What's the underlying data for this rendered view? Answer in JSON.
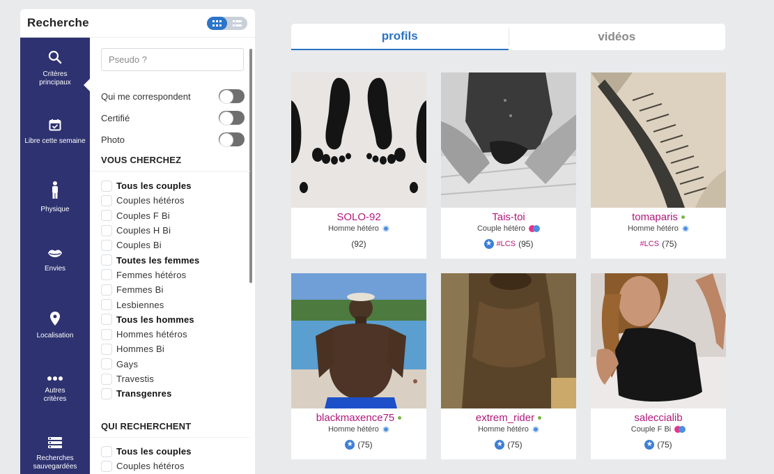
{
  "search_panel": {
    "title": "Recherche",
    "nav": [
      {
        "label_line1": "Critères",
        "label_line2": "principaux",
        "icon": "search-icon"
      },
      {
        "label_line1": "Libre cette semaine",
        "label_line2": "",
        "icon": "calendar-check-icon"
      },
      {
        "label_line1": "Physique",
        "label_line2": "",
        "icon": "person-icon"
      },
      {
        "label_line1": "Envies",
        "label_line2": "",
        "icon": "lips-icon"
      },
      {
        "label_line1": "Localisation",
        "label_line2": "",
        "icon": "map-pin-icon"
      },
      {
        "label_line1": "Autres",
        "label_line2": "critères",
        "icon": "more-dots-icon"
      },
      {
        "label_line1": "Recherches",
        "label_line2": "sauvegardées",
        "icon": "saved-list-icon"
      }
    ],
    "pseudo_placeholder": "Pseudo ?",
    "toggles": [
      {
        "label": "Qui me correspondent",
        "on": false
      },
      {
        "label": "Certifié",
        "on": false
      },
      {
        "label": "Photo",
        "on": false
      }
    ],
    "vous_cherchez": {
      "title": "VOUS CHERCHEZ",
      "options": [
        "Tous les couples",
        "Couples hétéros",
        "Couples F Bi",
        "Couples H Bi",
        "Couples Bi",
        "Toutes les femmes",
        "Femmes hétéros",
        "Femmes Bi",
        "Lesbiennes",
        "Tous les hommes",
        "Hommes hétéros",
        "Hommes Bi",
        "Gays",
        "Travestis",
        "Transgenres"
      ]
    },
    "qui_recherchent": {
      "title": "QUI RECHERCHENT",
      "options": [
        "Tous les couples",
        "Couples hétéros"
      ]
    }
  },
  "tabs": [
    {
      "label": "profils",
      "active": true
    },
    {
      "label": "vidéos",
      "active": false
    }
  ],
  "profiles": [
    {
      "name": "SOLO-92",
      "type": "Homme hétéro",
      "online": false,
      "badge": "verified",
      "star": false,
      "lcs": "",
      "dept": "(92)"
    },
    {
      "name": "Tais-toi",
      "type": "Couple hétéro",
      "online": false,
      "badge": "couple",
      "star": true,
      "lcs": "#LCS",
      "dept": "(95)"
    },
    {
      "name": "tomaparis",
      "type": "Homme hétéro",
      "online": true,
      "badge": "verified",
      "star": false,
      "lcs": "#LCS",
      "dept": "(75)"
    },
    {
      "name": "blackmaxence75",
      "type": "Homme hétéro",
      "online": true,
      "badge": "verified",
      "star": true,
      "lcs": "",
      "dept": "(75)"
    },
    {
      "name": "extrem_rider",
      "type": "Homme hétéro",
      "online": true,
      "badge": "verified",
      "star": true,
      "lcs": "",
      "dept": "(75)"
    },
    {
      "name": "saleccialib",
      "type": "Couple F Bi",
      "online": false,
      "badge": "couple",
      "star": true,
      "lcs": "",
      "dept": "(75)"
    }
  ],
  "colors": {
    "nav_bg": "#2e3270",
    "accent": "#2a73c4",
    "name": "#b0177a",
    "online": "#7cb342"
  }
}
